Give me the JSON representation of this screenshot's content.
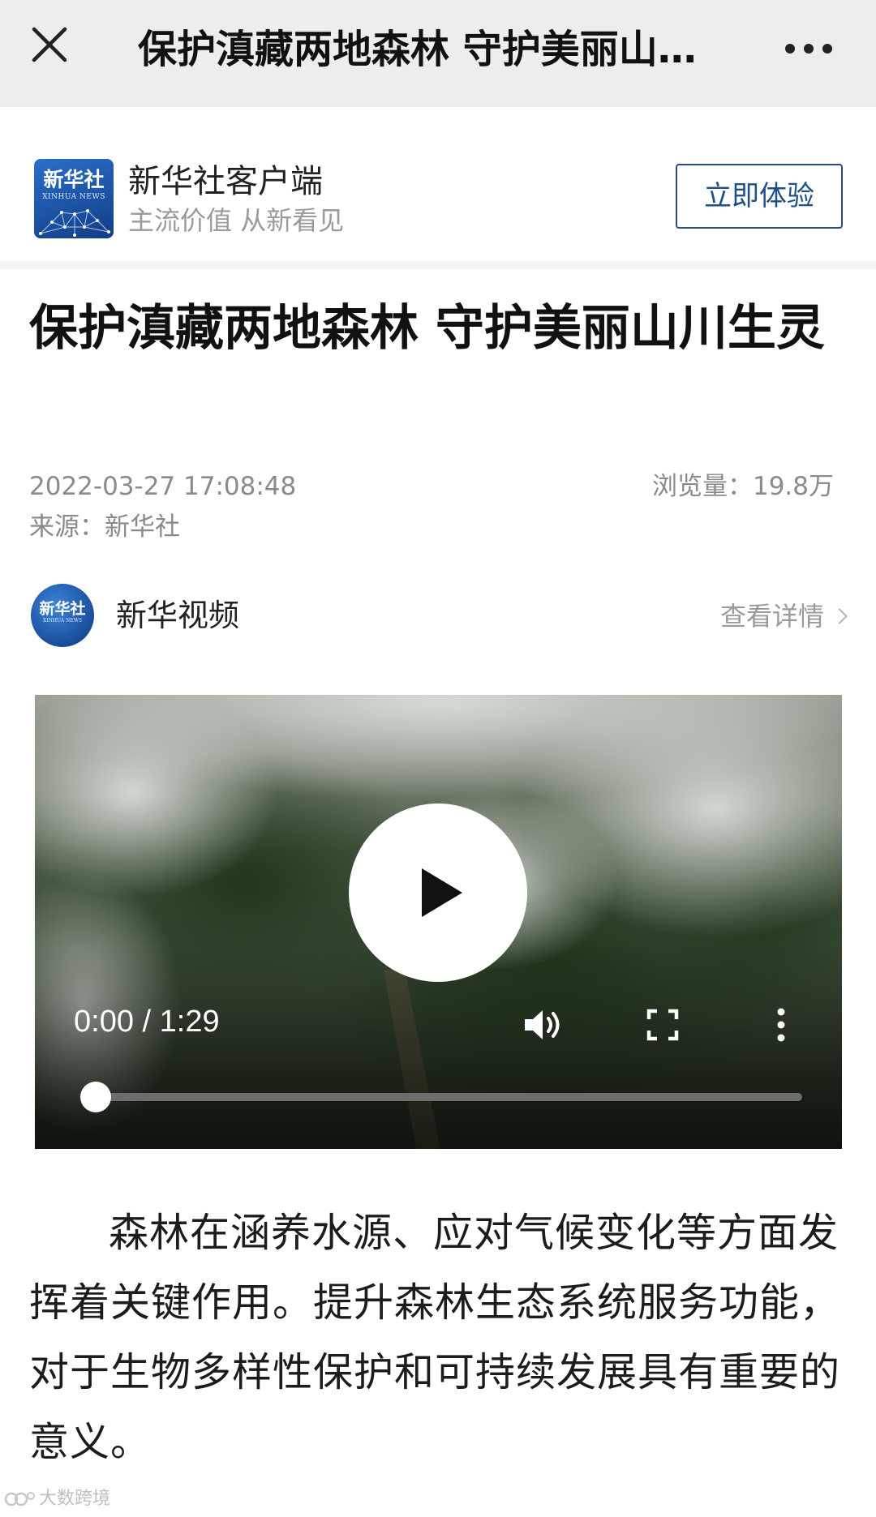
{
  "navbar": {
    "title": "保护滇藏两地森林 守护美丽山…",
    "close_icon": "close-icon",
    "more_icon": "more-horizontal-icon"
  },
  "banner": {
    "app_name": "新华社客户端",
    "slogan": "主流价值 从新看见",
    "button_label": "立即体验",
    "logo_text_cn": "新华社",
    "logo_text_en": "XINHUA NEWS"
  },
  "article": {
    "title": "保护滇藏两地森林 守护美丽山川生灵",
    "date": "2022-03-27 17:08:48",
    "views": "浏览量：19.8万",
    "source": "来源：新华社",
    "paragraph": "森林在涵养水源、应对气候变化等方面发挥着关键作用。提升森林生态系统服务功能，对于生物多样性保护和可持续发展具有重要的意义。"
  },
  "account": {
    "name": "新华视频",
    "view_details": "查看详情",
    "avatar_text_cn": "新华社",
    "avatar_text_en": "XINHUA NEWS"
  },
  "video": {
    "time": "0:00 / 1:29",
    "progress": 0,
    "icons": [
      "play-icon",
      "volume-icon",
      "fullscreen-icon",
      "more-vertical-icon"
    ]
  },
  "watermark": {
    "text": "大数跨境"
  },
  "colors": {
    "nav_bg": "#ededed",
    "button_border": "#2c4e77",
    "button_text": "#1f4f86",
    "meta_gray": "#8a8a8a",
    "brand_blue": "#1a4d98"
  }
}
